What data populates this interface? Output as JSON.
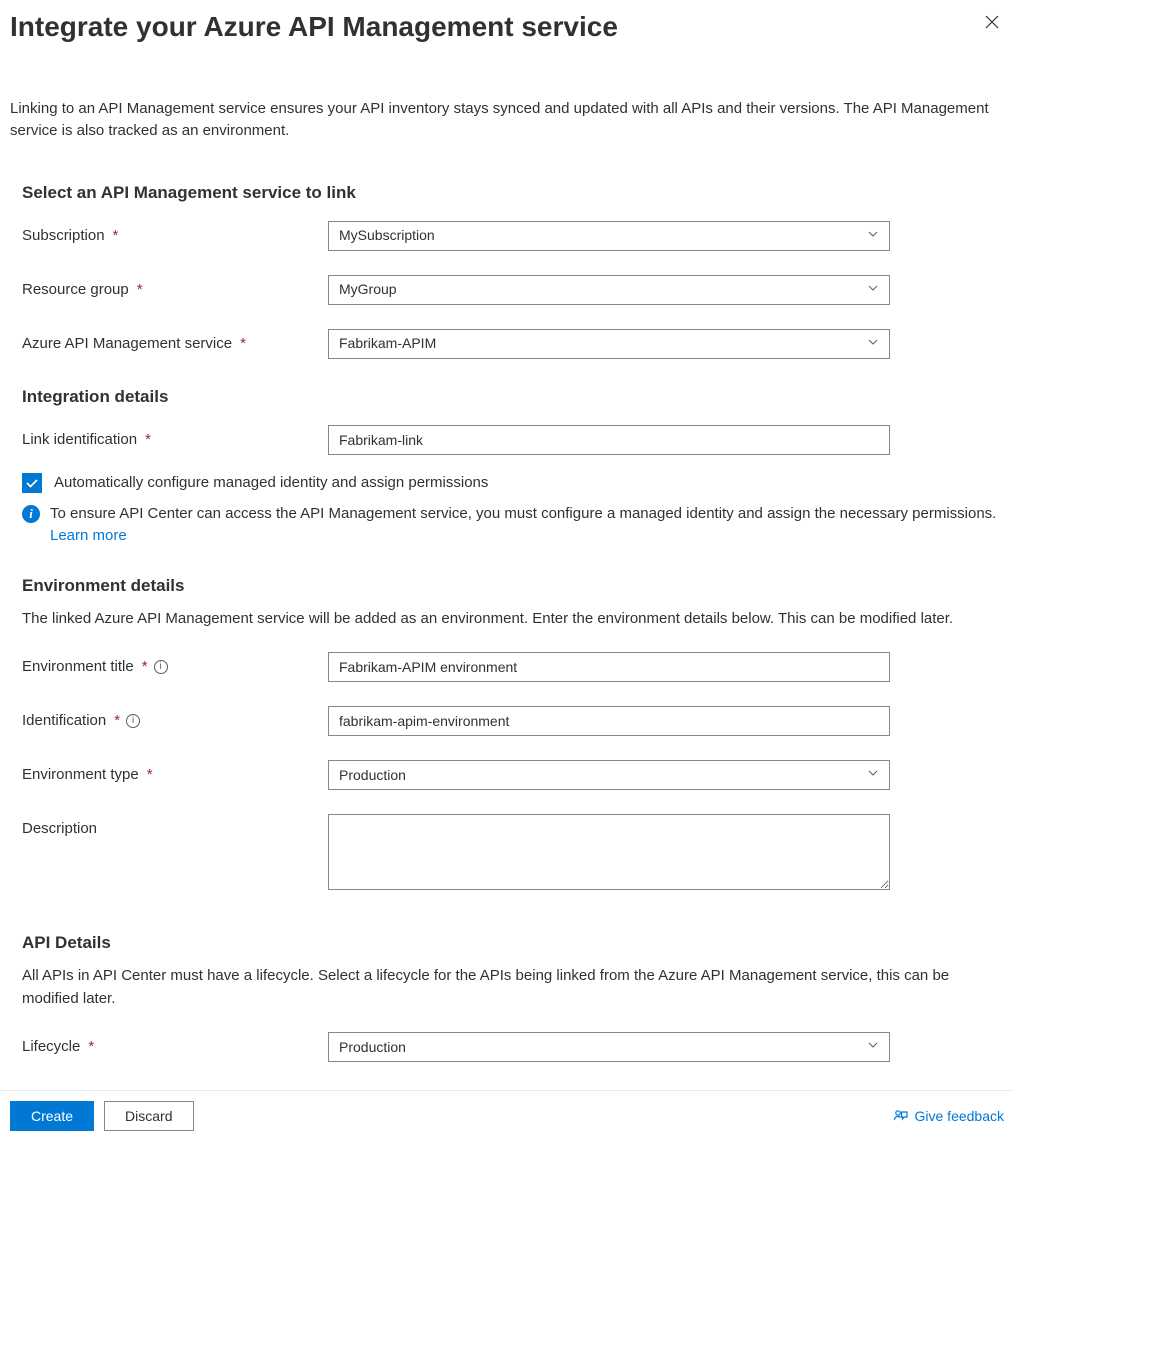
{
  "header": {
    "title": "Integrate your Azure API Management service"
  },
  "intro": "Linking to an API Management service ensures your API inventory stays synced and updated with all APIs and their versions. The API Management service is also tracked as an environment.",
  "section_select": {
    "heading": "Select an API Management service to link",
    "subscription_label": "Subscription",
    "subscription_value": "MySubscription",
    "resource_group_label": "Resource group",
    "resource_group_value": "MyGroup",
    "apim_label": "Azure API Management service",
    "apim_value": "Fabrikam-APIM"
  },
  "section_integration": {
    "heading": "Integration details",
    "link_id_label": "Link identification",
    "link_id_value": "Fabrikam-link",
    "checkbox_label": "Automatically configure managed identity and assign permissions",
    "info_text": "To ensure API Center can access the API Management service, you must configure a managed identity and assign the necessary permissions. ",
    "learn_more": "Learn more"
  },
  "section_env": {
    "heading": "Environment details",
    "desc": "The linked Azure API Management service will be added as an environment. Enter the environment details below. This can be modified later.",
    "title_label": "Environment title",
    "title_value": "Fabrikam-APIM environment",
    "id_label": "Identification",
    "id_value": "fabrikam-apim-environment",
    "type_label": "Environment type",
    "type_value": "Production",
    "desc_label": "Description",
    "desc_value": ""
  },
  "section_api": {
    "heading": "API Details",
    "desc": "All APIs in API Center must have a lifecycle. Select a lifecycle for the APIs being linked from the Azure API Management service, this can be modified later.",
    "lifecycle_label": "Lifecycle",
    "lifecycle_value": "Production"
  },
  "footer": {
    "create": "Create",
    "discard": "Discard",
    "feedback": "Give feedback"
  }
}
